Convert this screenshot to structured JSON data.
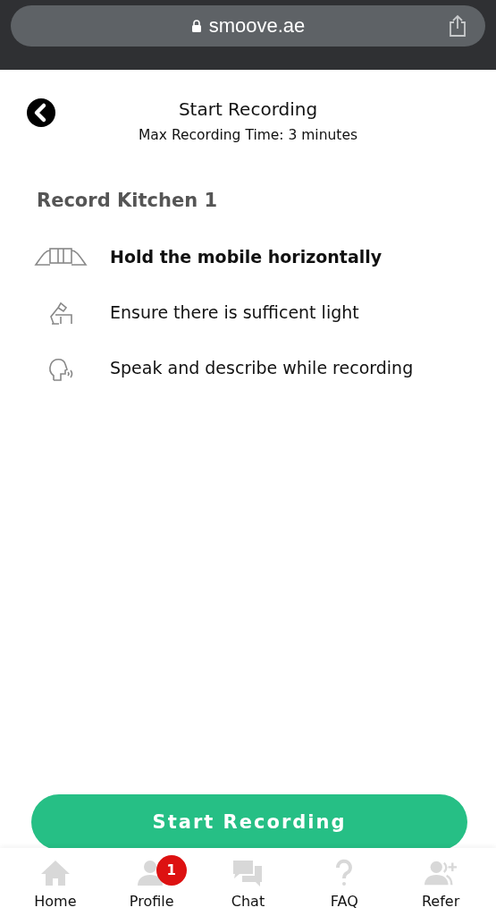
{
  "browser": {
    "url": "smoove.ae"
  },
  "header": {
    "title": "Start Recording",
    "subtitle": "Max Recording Time: 3 minutes"
  },
  "section_title": "Record Kitchen 1",
  "tips": [
    {
      "kind": "hands",
      "text": "Hold the mobile horizontally",
      "bold": true
    },
    {
      "kind": "lamp",
      "text": "Ensure there is sufficent light",
      "bold": false
    },
    {
      "kind": "speaker",
      "text": "Speak and describe while recording",
      "bold": false
    }
  ],
  "primary_button": "Start Recording",
  "nav": [
    {
      "kind": "home",
      "label": "Home"
    },
    {
      "kind": "profile",
      "label": "Profile",
      "badge": "1"
    },
    {
      "kind": "chat",
      "label": "Chat"
    },
    {
      "kind": "faq",
      "label": "FAQ"
    },
    {
      "kind": "refer",
      "label": "Refer"
    }
  ]
}
